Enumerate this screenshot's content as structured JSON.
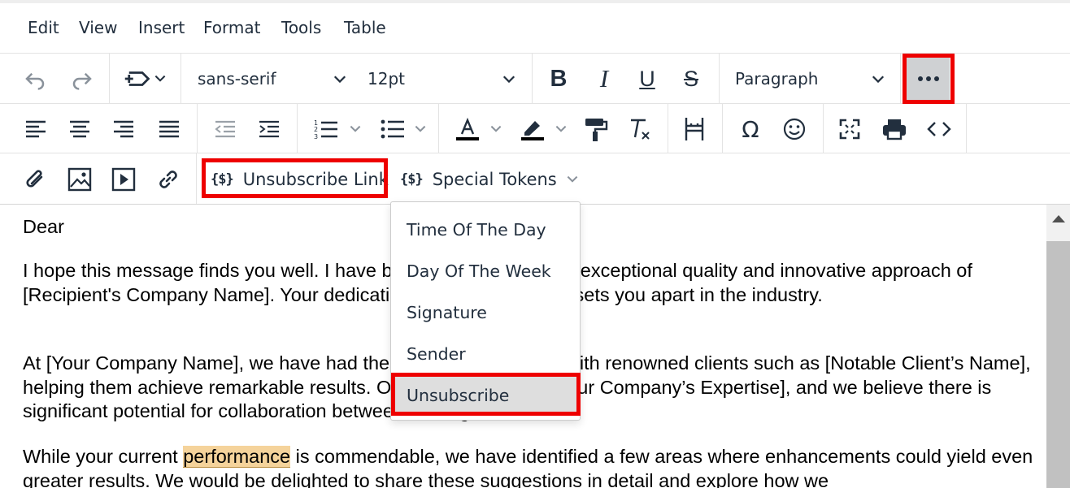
{
  "menubar": {
    "items": [
      "Edit",
      "View",
      "Insert",
      "Format",
      "Tools",
      "Table"
    ]
  },
  "toolbar": {
    "font_family": "sans-serif",
    "font_size": "12pt",
    "block_format": "Paragraph",
    "unsubscribe_link_label": "Unsubscribe Link",
    "special_tokens_label": "Special Tokens",
    "token_icon_glyph": "{$}"
  },
  "dropdown": {
    "items": [
      "Time Of The Day",
      "Day Of The Week",
      "Signature",
      "Sender",
      "Unsubscribe"
    ],
    "active_item": "Unsubscribe"
  },
  "content": {
    "greeting": "Dear",
    "p1": "I hope this message finds you well. I have been impressed by the exceptional quality and innovative approach of [Recipient's Company Name]. Your dedication to excellence truly sets you apart in the industry.",
    "p2": "At [Your Company Name], we have had the pleasure of working with renowned clients such as [Notable Client’s Name], helping them achieve remarkable results. Our expertise lies in [Your Company’s Expertise], and we believe there is significant potential for collaboration between our organizations.",
    "p3_before": "While your current ",
    "p3_highlight": "performance",
    "p3_after": " is commendable, we have identified a few areas where enhancements could yield even greater results. We would be delighted to share these suggestions in detail and explore how we"
  },
  "highlights": {
    "color": "#ee0000"
  },
  "colors": {
    "text_color_bar": "#000000",
    "highlight_color_bar": "#000000"
  }
}
